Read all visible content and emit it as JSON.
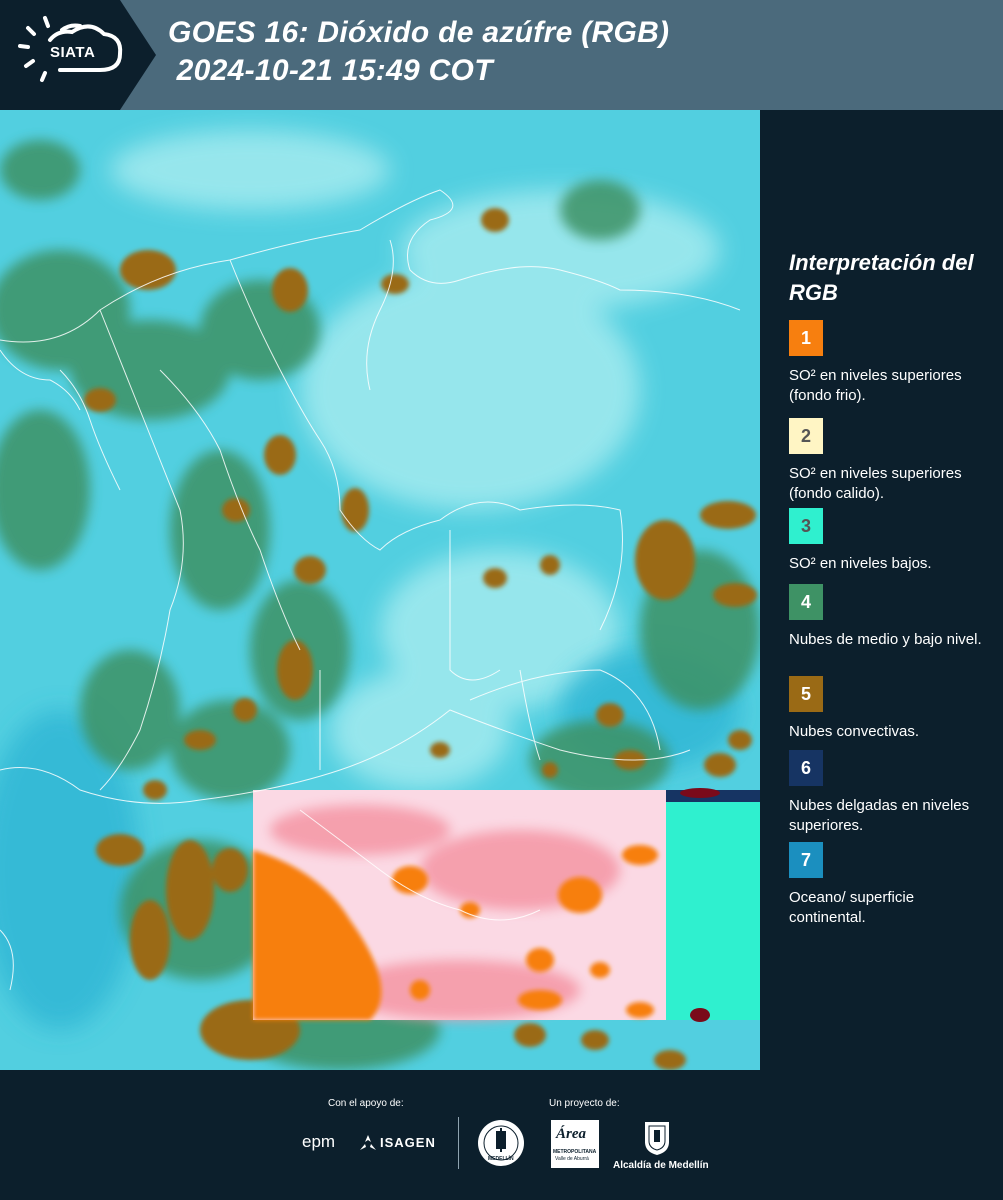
{
  "header": {
    "logo_text": "SIATA",
    "title_line1": "GOES 16: Dióxido de azúfre (RGB)",
    "title_line2": " 2024-10-21 15:49 COT"
  },
  "legend": {
    "title": "Interpretación del RGB",
    "items": [
      {
        "number": "1",
        "label": "SO² en niveles superiores (fondo frio).",
        "color": "#f77f0f",
        "text_color": "#ffffff"
      },
      {
        "number": "2",
        "label": "SO² en niveles superiores (fondo calido).",
        "color": "#fff5c4",
        "text_color": "#555555"
      },
      {
        "number": "3",
        "label": "SO² en niveles bajos.",
        "color": "#2ff0cf",
        "text_color": "#555555"
      },
      {
        "number": "4",
        "label": "Nubes de medio y bajo nivel.",
        "color": "#3e9265",
        "text_color": "#ffffff"
      },
      {
        "number": "5",
        "label": "Nubes convectivas.",
        "color": "#9a6a15",
        "text_color": "#ffffff"
      },
      {
        "number": "6",
        "label": "Nubes delgadas en niveles superiores.",
        "color": "#163463",
        "text_color": "#ffffff"
      },
      {
        "number": "7",
        "label": "Oceano/ superficie continental.",
        "color": "#1b8fbf",
        "text_color": "#ffffff"
      }
    ]
  },
  "footer": {
    "support_label": "Con el apoyo de:",
    "project_label": "Un proyecto de:",
    "logos": {
      "epm": "epm",
      "isagen": "ISAGEN",
      "area": "Área",
      "area_sub1": "METROPOLITANA",
      "area_sub2": "Valle de Aburrá",
      "alcaldia": "Alcaldía de Medellín",
      "medellin_seal": "MEDELLÍN"
    }
  }
}
